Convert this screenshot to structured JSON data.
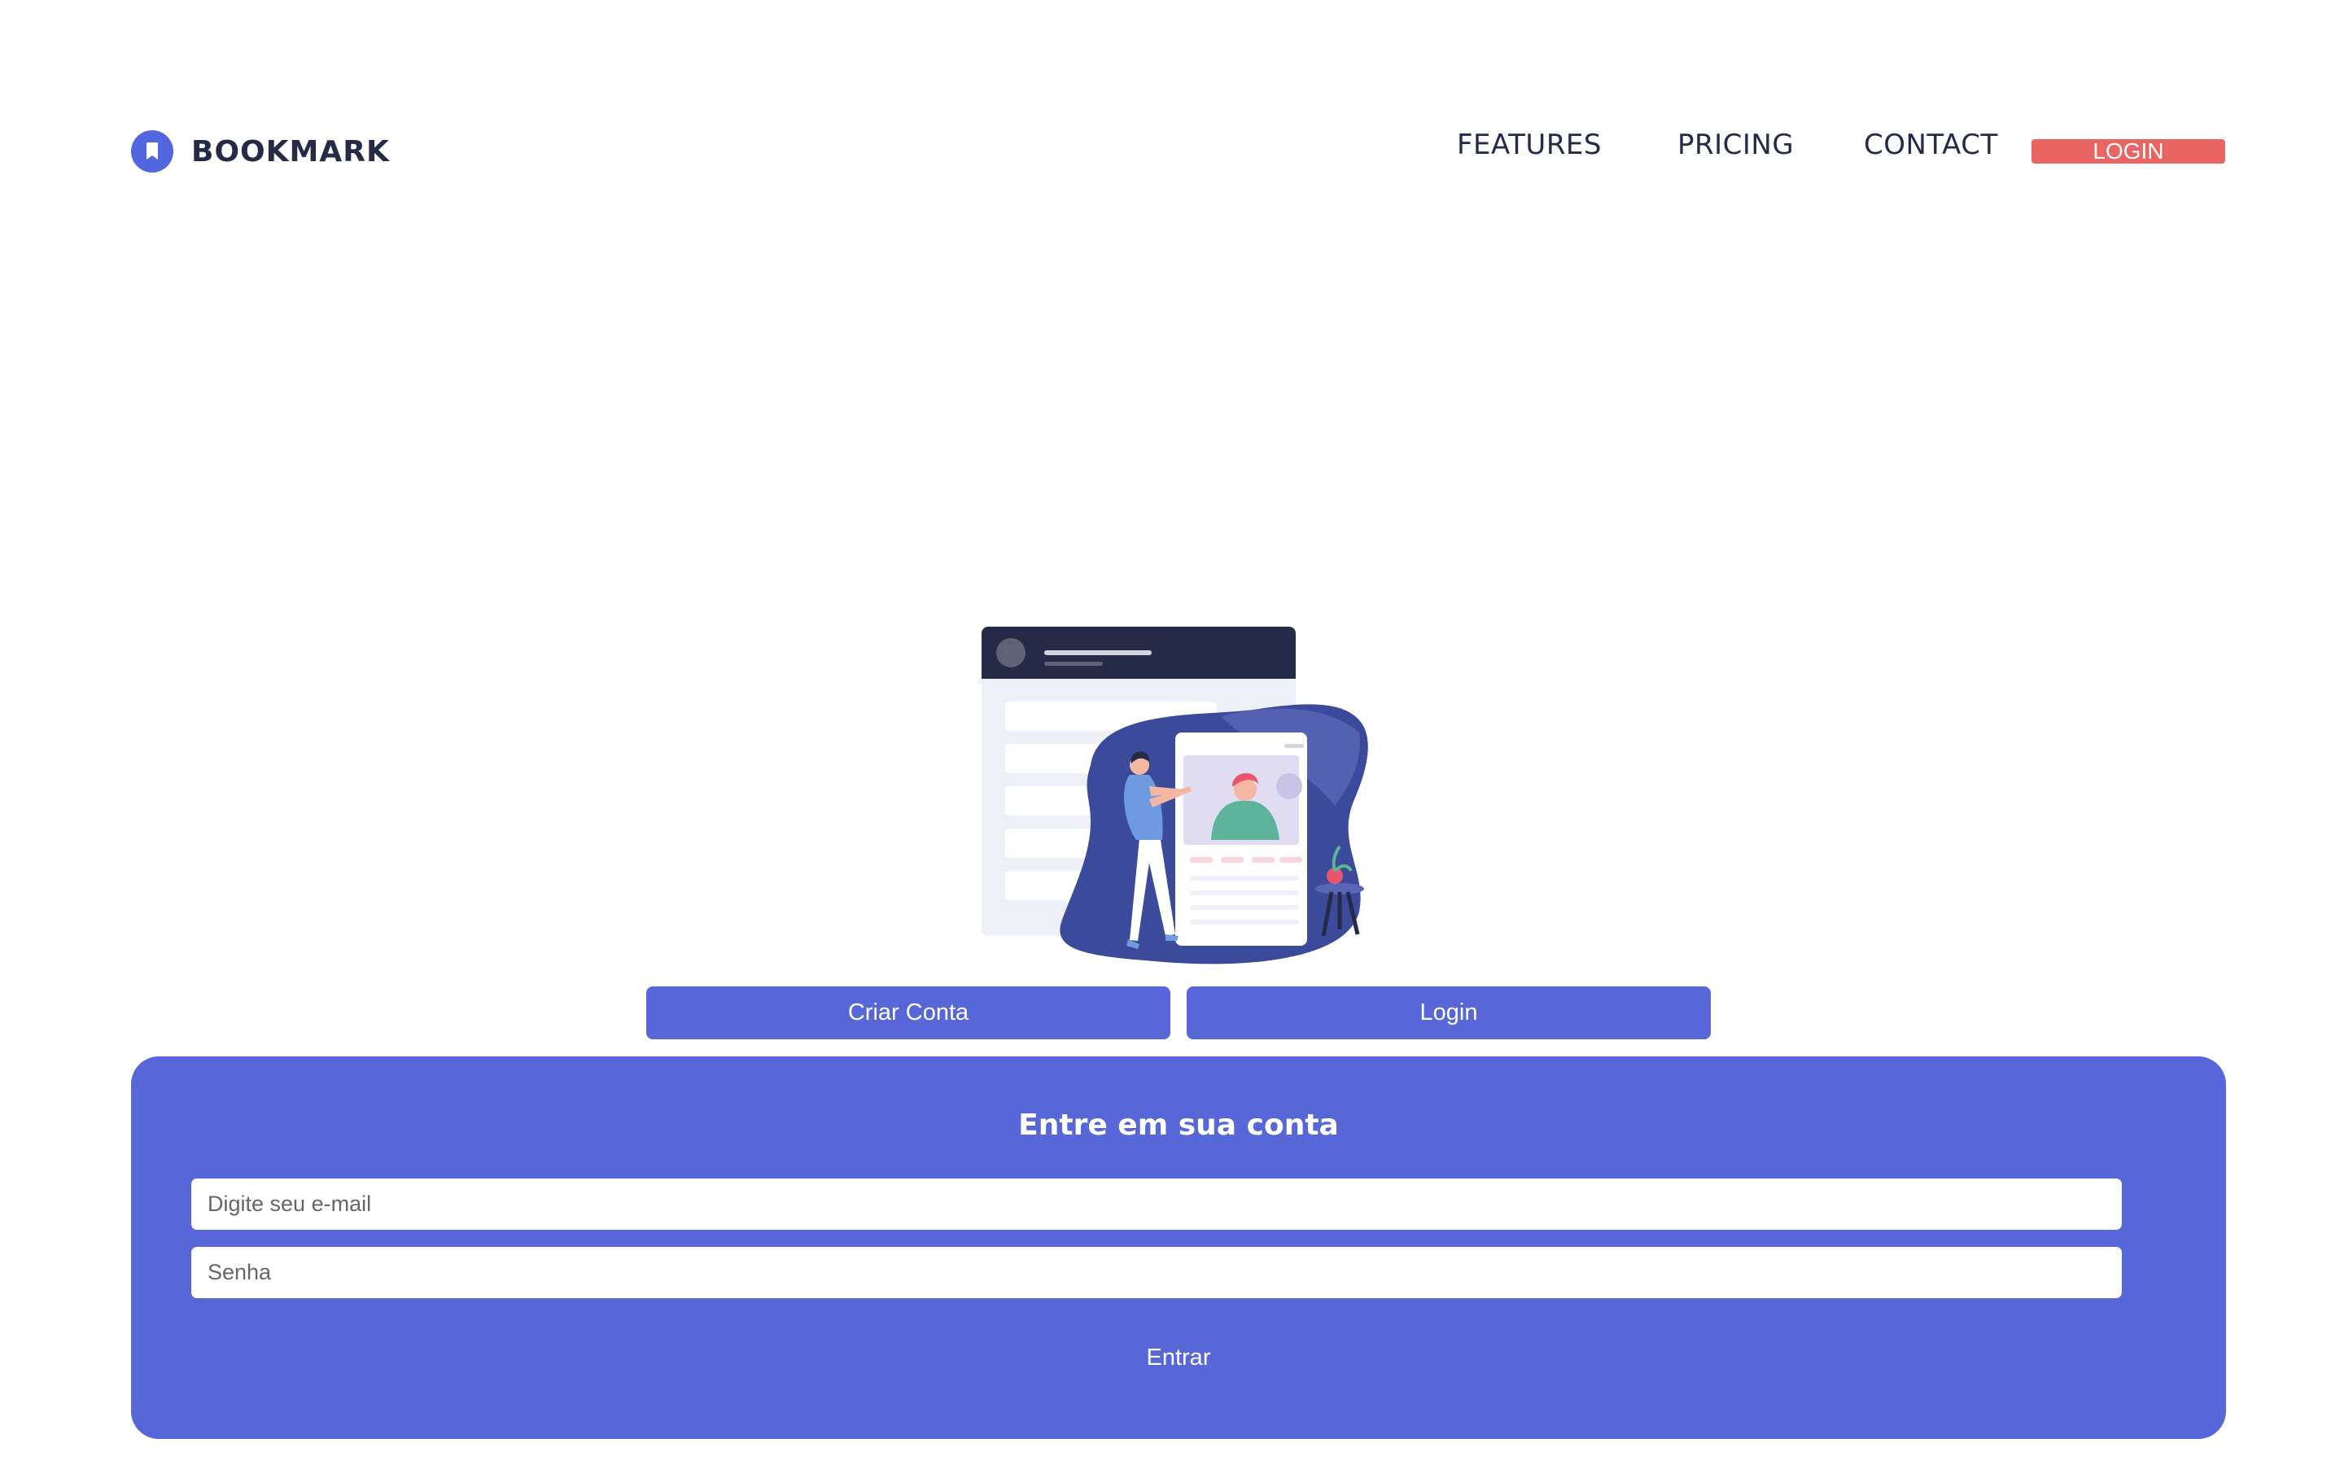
{
  "header": {
    "brand": "BOOKMARK",
    "brand_icon": "bookmark-icon",
    "nav": {
      "features": "FEATURES",
      "pricing": "PRICING",
      "contact": "CONTACT",
      "login": "LOGIN"
    }
  },
  "tabs": {
    "create_account": "Criar Conta",
    "login": "Login"
  },
  "login_form": {
    "title": "Entre em sua conta",
    "email_placeholder": "Digite seu e-mail",
    "password_placeholder": "Senha",
    "submit": "Entrar"
  },
  "colors": {
    "brand_blue": "#5267DF",
    "panel_blue": "#5767D8",
    "login_red": "#E96563",
    "dark_navy": "#252B46"
  }
}
